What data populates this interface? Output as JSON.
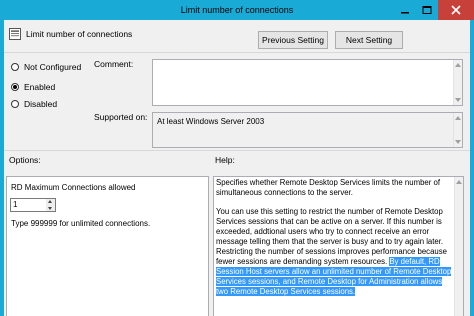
{
  "window": {
    "title": "Limit number of connections"
  },
  "header": {
    "label": "Limit number of connections",
    "previous_button": "Previous Setting",
    "next_button": "Next Setting"
  },
  "state": {
    "options": [
      {
        "label": "Not Configured",
        "selected": false
      },
      {
        "label": "Enabled",
        "selected": true
      },
      {
        "label": "Disabled",
        "selected": false
      }
    ]
  },
  "comment": {
    "label": "Comment:",
    "value": ""
  },
  "supported": {
    "label": "Supported on:",
    "value": "At least Windows Server 2003"
  },
  "options_section": {
    "label": "Options:",
    "field_label": "RD Maximum Connections allowed",
    "field_value": "1",
    "hint": "Type 999999 for unlimited connections."
  },
  "help_section": {
    "label": "Help:",
    "para1": "Specifies whether Remote Desktop Services limits the number of simultaneous connections to the server.",
    "para2_plain": "You can use this setting to restrict the number of Remote Desktop Services sessions that can be active on a server. If this number is exceeded, addtional users who try to connect receive an error message telling them that the server is busy and to try again later. Restricting the number of sessions improves performance because fewer sessions are demanding system resources.",
    "para2_selected": "By default, RD Session Host servers allow an unlimited number of Remote Desktop Services sessions, and Remote Desktop for Administration allows two Remote Desktop Services sessions."
  },
  "colors": {
    "titlebar": "#1aaad6",
    "close_button": "#c7403a",
    "selection": "#3399ff"
  }
}
